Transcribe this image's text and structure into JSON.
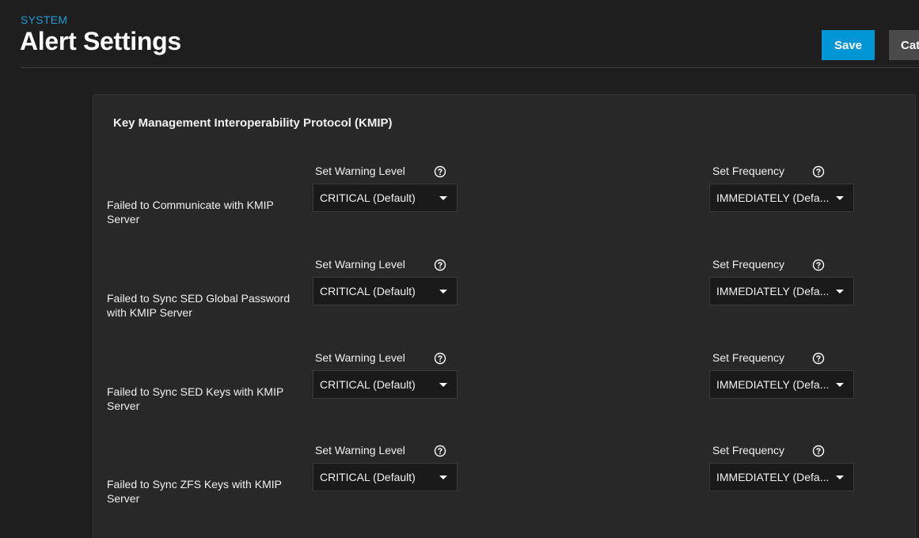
{
  "header": {
    "breadcrumb": "SYSTEM",
    "title": "Alert Settings",
    "save_label": "Save",
    "categories_label": "Cat"
  },
  "card": {
    "title": "Key Management Interoperability Protocol (KMIP)",
    "rows": [
      {
        "label": "Failed to Communicate with KMIP Server",
        "warning_label": "Set Warning Level",
        "warning_value": "CRITICAL (Default)",
        "frequency_label": "Set Frequency",
        "frequency_value": "IMMEDIATELY (Defa..."
      },
      {
        "label": "Failed to Sync SED Global Password with KMIP Server",
        "warning_label": "Set Warning Level",
        "warning_value": "CRITICAL (Default)",
        "frequency_label": "Set Frequency",
        "frequency_value": "IMMEDIATELY (Defa..."
      },
      {
        "label": "Failed to Sync SED Keys with KMIP Server",
        "warning_label": "Set Warning Level",
        "warning_value": "CRITICAL (Default)",
        "frequency_label": "Set Frequency",
        "frequency_value": "IMMEDIATELY (Defa..."
      },
      {
        "label": "Failed to Sync ZFS Keys with KMIP Server",
        "warning_label": "Set Warning Level",
        "warning_value": "CRITICAL (Default)",
        "frequency_label": "Set Frequency",
        "frequency_value": "IMMEDIATELY (Defa..."
      }
    ]
  },
  "icons": {
    "help": "help-circle-icon",
    "dropdown": "caret-down-icon"
  },
  "colors": {
    "accent": "#0095d5",
    "breadcrumb": "#1e9bd7",
    "background": "#1e1e1e",
    "card": "#282828"
  }
}
